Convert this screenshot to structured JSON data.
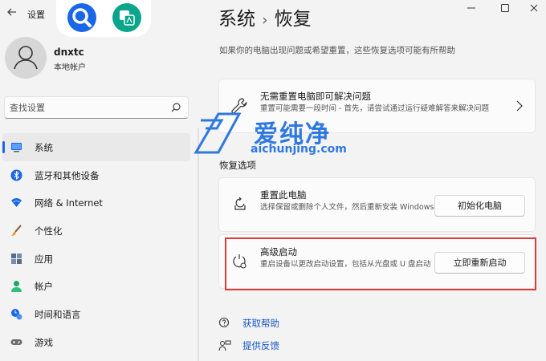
{
  "titlebar": {
    "app_title": "设置",
    "back_icon": "back-arrow-icon"
  },
  "overlay": {
    "icons": [
      "search-circle-icon",
      "translate-icon"
    ],
    "colors": {
      "search": "#1a66e8",
      "translate": "#0aa58a"
    }
  },
  "user": {
    "name": "dnxtc",
    "account_type": "本地帐户"
  },
  "search": {
    "placeholder": "查找设置"
  },
  "sidebar": {
    "items": [
      {
        "label": "系统",
        "icon": "system-icon",
        "active": true
      },
      {
        "label": "蓝牙和其他设备",
        "icon": "bluetooth-icon"
      },
      {
        "label": "网络 & Internet",
        "icon": "wifi-icon"
      },
      {
        "label": "个性化",
        "icon": "brush-icon"
      },
      {
        "label": "应用",
        "icon": "apps-icon"
      },
      {
        "label": "帐户",
        "icon": "account-icon"
      },
      {
        "label": "时间和语言",
        "icon": "clock-globe-icon"
      },
      {
        "label": "游戏",
        "icon": "gamepad-icon"
      }
    ]
  },
  "header": {
    "breadcrumb_parent": "系统",
    "breadcrumb_sep": "›",
    "breadcrumb_current": "恢复",
    "description": "如果你的电脑出现问题或希望重置，这些恢复选项可能有所帮助"
  },
  "fix_card": {
    "title": "无需重置电脑即可解决问题",
    "desc": "重置可能需要一段时间 - 首先，请尝试通过运行疑难解答来解决问题"
  },
  "recovery": {
    "section_title": "恢复选项",
    "reset": {
      "title": "重置此电脑",
      "desc": "选择保留或删除个人文件，然后重新安装 Windows",
      "button": "初始化电脑"
    },
    "advanced": {
      "title": "高级启动",
      "desc": "重启设备以更改启动设置，包括从光盘或 U 盘启动",
      "button": "立即重新启动"
    }
  },
  "links": {
    "help": "获取帮助",
    "feedback": "提供反馈"
  },
  "watermark": {
    "brand": "爱纯净",
    "url": "aichunjing.com"
  },
  "colors": {
    "accent": "#1a66e8",
    "link": "#1a56c4",
    "highlight": "#e03b3b",
    "watermark": "#2f78e0"
  }
}
